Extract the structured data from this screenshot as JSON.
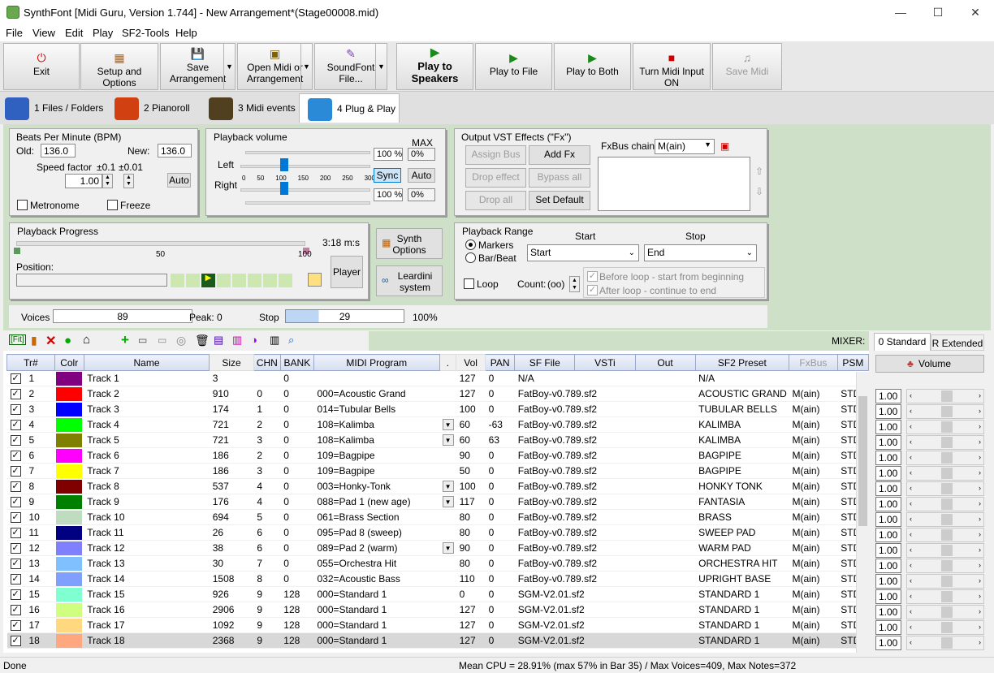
{
  "window": {
    "title": "SynthFont [Midi Guru, Version 1.744] - New Arrangement*(Stage00008.mid)"
  },
  "menu": [
    "File",
    "View",
    "Edit",
    "Play",
    "SF2-Tools",
    "Help"
  ],
  "toolbar": {
    "exit": "Exit",
    "setup": "Setup and Options",
    "save1": "Save",
    "save2": "Arrangement",
    "open1": "Open Midi or",
    "open2": "Arrangement",
    "sf1": "SoundFont",
    "sf2": "File...",
    "play1": "Play to",
    "play2": "Speakers",
    "playfile": "Play to File",
    "playboth": "Play to Both",
    "midiin": "Turn Midi Input ON",
    "savemidi": "Save Midi"
  },
  "tabs": [
    "1 Files / Folders",
    "2 Pianoroll",
    "3 Midi events",
    "4 Plug & Play"
  ],
  "bpm": {
    "title": "Beats Per Minute (BPM)",
    "old_label": "Old:",
    "old": "136.0",
    "new_label": "New:",
    "new": "136.0",
    "speed_label": "Speed factor",
    "step1": "±0.1",
    "step2": "±0.01",
    "speed": "1.00",
    "auto": "Auto",
    "metronome": "Metronome",
    "freeze": "Freeze"
  },
  "volume": {
    "title": "Playback volume",
    "max": "MAX",
    "left": "Left",
    "right": "Right",
    "lpct": "100 %",
    "lmax": "0%",
    "rpct": "100 %",
    "rmax": "0%",
    "sync": "Sync",
    "auto": "Auto",
    "ticks": [
      "0",
      "50",
      "100",
      "150",
      "200",
      "250",
      "300"
    ]
  },
  "vst": {
    "title": "Output VST Effects (\"Fx\")",
    "assign": "Assign Bus",
    "addfx": "Add Fx",
    "drop": "Drop effect",
    "bypass": "Bypass all",
    "dropall": "Drop all",
    "setdefault": "Set Default",
    "chain_label": "FxBus chain",
    "chain": "M(ain)"
  },
  "progress": {
    "title": "Playback Progress",
    "time": "3:18 m:s",
    "tick_mid": "50",
    "tick_end": "100",
    "position": "Position:",
    "player": "Player"
  },
  "side": {
    "synth1": "Synth",
    "synth2": "Options",
    "lear1": "Leardini",
    "lear2": "system"
  },
  "range": {
    "title": "Playback Range",
    "start_label": "Start",
    "stop_label": "Stop",
    "markers": "Markers",
    "barbeat": "Bar/Beat",
    "start": "Start",
    "stop": "End",
    "loop": "Loop",
    "count_label": "Count:",
    "count": "(oo)",
    "before": "Before loop - start from beginning",
    "after": "After loop - continue to end"
  },
  "voices": {
    "label": "Voices",
    "value": "89",
    "peak": "Peak: 0",
    "stop": "Stop",
    "stopval": "29",
    "pct": "100%"
  },
  "mixer": {
    "label": "MIXER:",
    "tab_std": "0 Standard",
    "tab_ext": "R Extended",
    "volume": "Volume",
    "value": "1.00"
  },
  "headers": [
    "Tr#",
    "Colr",
    "Name",
    "Size",
    "CHN",
    "BANK",
    "MIDI Program",
    ".",
    "Vol",
    "PAN",
    "SF File",
    "VSTi",
    "Out",
    "SF2 Preset",
    "FxBus",
    "PSM"
  ],
  "rows": [
    [
      "1",
      "#800080",
      "Track 1",
      "3",
      "",
      "0",
      "",
      "",
      "127",
      "0",
      "N/A",
      "N/A",
      "",
      ""
    ],
    [
      "2",
      "#ff0000",
      "Track 2",
      "910",
      "0",
      "0",
      "000=Acoustic Grand",
      "",
      "127",
      "0",
      "FatBoy-v0.789.sf2",
      "ACOUSTIC GRAND",
      "M(ain)",
      "STD"
    ],
    [
      "3",
      "#0000ff",
      "Track 3",
      "174",
      "1",
      "0",
      "014=Tubular Bells",
      "",
      "100",
      "0",
      "FatBoy-v0.789.sf2",
      "TUBULAR BELLS",
      "M(ain)",
      "STD"
    ],
    [
      "4",
      "#00ff00",
      "Track 4",
      "721",
      "2",
      "0",
      "108=Kalimba",
      "d",
      "60",
      "-63",
      "FatBoy-v0.789.sf2",
      "KALIMBA",
      "M(ain)",
      "STD"
    ],
    [
      "5",
      "#808000",
      "Track 5",
      "721",
      "3",
      "0",
      "108=Kalimba",
      "d",
      "60",
      "63",
      "FatBoy-v0.789.sf2",
      "KALIMBA",
      "M(ain)",
      "STD"
    ],
    [
      "6",
      "#ff00ff",
      "Track 6",
      "186",
      "2",
      "0",
      "109=Bagpipe",
      "",
      "90",
      "0",
      "FatBoy-v0.789.sf2",
      "BAGPIPE",
      "M(ain)",
      "STD"
    ],
    [
      "7",
      "#ffff00",
      "Track 7",
      "186",
      "3",
      "0",
      "109=Bagpipe",
      "",
      "50",
      "0",
      "FatBoy-v0.789.sf2",
      "BAGPIPE",
      "M(ain)",
      "STD"
    ],
    [
      "8",
      "#800000",
      "Track 8",
      "537",
      "4",
      "0",
      "003=Honky-Tonk",
      "d",
      "100",
      "0",
      "FatBoy-v0.789.sf2",
      "HONKY TONK",
      "M(ain)",
      "STD"
    ],
    [
      "9",
      "#008000",
      "Track 9",
      "176",
      "4",
      "0",
      "088=Pad 1 (new age)",
      "d",
      "117",
      "0",
      "FatBoy-v0.789.sf2",
      "FANTASIA",
      "M(ain)",
      "STD"
    ],
    [
      "10",
      "#c0dcc0",
      "Track 10",
      "694",
      "5",
      "0",
      "061=Brass Section",
      "",
      "80",
      "0",
      "FatBoy-v0.789.sf2",
      "BRASS",
      "M(ain)",
      "STD"
    ],
    [
      "11",
      "#000080",
      "Track 11",
      "26",
      "6",
      "0",
      "095=Pad 8 (sweep)",
      "",
      "80",
      "0",
      "FatBoy-v0.789.sf2",
      "SWEEP PAD",
      "M(ain)",
      "STD"
    ],
    [
      "12",
      "#8080ff",
      "Track 12",
      "38",
      "6",
      "0",
      "089=Pad 2 (warm)",
      "d",
      "90",
      "0",
      "FatBoy-v0.789.sf2",
      "WARM PAD",
      "M(ain)",
      "STD"
    ],
    [
      "13",
      "#80c0ff",
      "Track 13",
      "30",
      "7",
      "0",
      "055=Orchestra Hit",
      "",
      "80",
      "0",
      "FatBoy-v0.789.sf2",
      "ORCHESTRA HIT",
      "M(ain)",
      "STD"
    ],
    [
      "14",
      "#80a0ff",
      "Track 14",
      "1508",
      "8",
      "0",
      "032=Acoustic Bass",
      "",
      "110",
      "0",
      "FatBoy-v0.789.sf2",
      "UPRIGHT BASE",
      "M(ain)",
      "STD"
    ],
    [
      "15",
      "#80ffd0",
      "Track 15",
      "926",
      "9",
      "128",
      "000=Standard 1",
      "",
      "0",
      "0",
      "SGM-V2.01.sf2",
      "STANDARD 1",
      "M(ain)",
      "STD"
    ],
    [
      "16",
      "#d0ff80",
      "Track 16",
      "2906",
      "9",
      "128",
      "000=Standard 1",
      "",
      "127",
      "0",
      "SGM-V2.01.sf2",
      "STANDARD 1",
      "M(ain)",
      "STD"
    ],
    [
      "17",
      "#ffd880",
      "Track 17",
      "1092",
      "9",
      "128",
      "000=Standard 1",
      "",
      "127",
      "0",
      "SGM-V2.01.sf2",
      "STANDARD 1",
      "M(ain)",
      "STD"
    ],
    [
      "18",
      "#ffa880",
      "Track 18",
      "2368",
      "9",
      "128",
      "000=Standard 1",
      "",
      "127",
      "0",
      "SGM-V2.01.sf2",
      "STANDARD 1",
      "M(ain)",
      "STD"
    ]
  ],
  "status": {
    "left": "Done",
    "center": "Mean CPU = 28.91% (max 57% in Bar 35) / Max Voices=409, Max Notes=372"
  }
}
